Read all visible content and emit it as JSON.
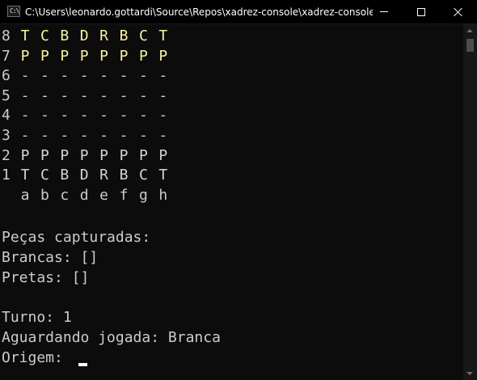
{
  "window": {
    "title": "C:\\Users\\leonardo.gottardi\\Source\\Repos\\xadrez-console\\xadrez-console\\bin\\...",
    "icon": "console-icon",
    "icon_text": "C:\\"
  },
  "board": {
    "ranks": [
      {
        "label": "8",
        "cells": [
          "T",
          "C",
          "B",
          "D",
          "R",
          "B",
          "C",
          "T"
        ],
        "color": "black"
      },
      {
        "label": "7",
        "cells": [
          "P",
          "P",
          "P",
          "P",
          "P",
          "P",
          "P",
          "P"
        ],
        "color": "black"
      },
      {
        "label": "6",
        "cells": [
          "-",
          "-",
          "-",
          "-",
          "-",
          "-",
          "-",
          "-"
        ],
        "color": "empty"
      },
      {
        "label": "5",
        "cells": [
          "-",
          "-",
          "-",
          "-",
          "-",
          "-",
          "-",
          "-"
        ],
        "color": "empty"
      },
      {
        "label": "4",
        "cells": [
          "-",
          "-",
          "-",
          "-",
          "-",
          "-",
          "-",
          "-"
        ],
        "color": "empty"
      },
      {
        "label": "3",
        "cells": [
          "-",
          "-",
          "-",
          "-",
          "-",
          "-",
          "-",
          "-"
        ],
        "color": "empty"
      },
      {
        "label": "2",
        "cells": [
          "P",
          "P",
          "P",
          "P",
          "P",
          "P",
          "P",
          "P"
        ],
        "color": "white"
      },
      {
        "label": "1",
        "cells": [
          "T",
          "C",
          "B",
          "D",
          "R",
          "B",
          "C",
          "T"
        ],
        "color": "white"
      }
    ],
    "files": [
      "a",
      "b",
      "c",
      "d",
      "e",
      "f",
      "g",
      "h"
    ]
  },
  "console": {
    "captured_header": "Peças capturadas:",
    "white_captured": "Brancas: []",
    "black_captured": "Pretas: []",
    "turn": "Turno: 1",
    "waiting": "Aguardando jogada: Branca",
    "origin_prompt": "Origem: "
  },
  "colors": {
    "background": "#0c0c0c",
    "text": "#cccccc",
    "white_pieces": "#d4d4d4",
    "black_pieces": "#f9f1a5",
    "cursor": "#ffffff"
  }
}
